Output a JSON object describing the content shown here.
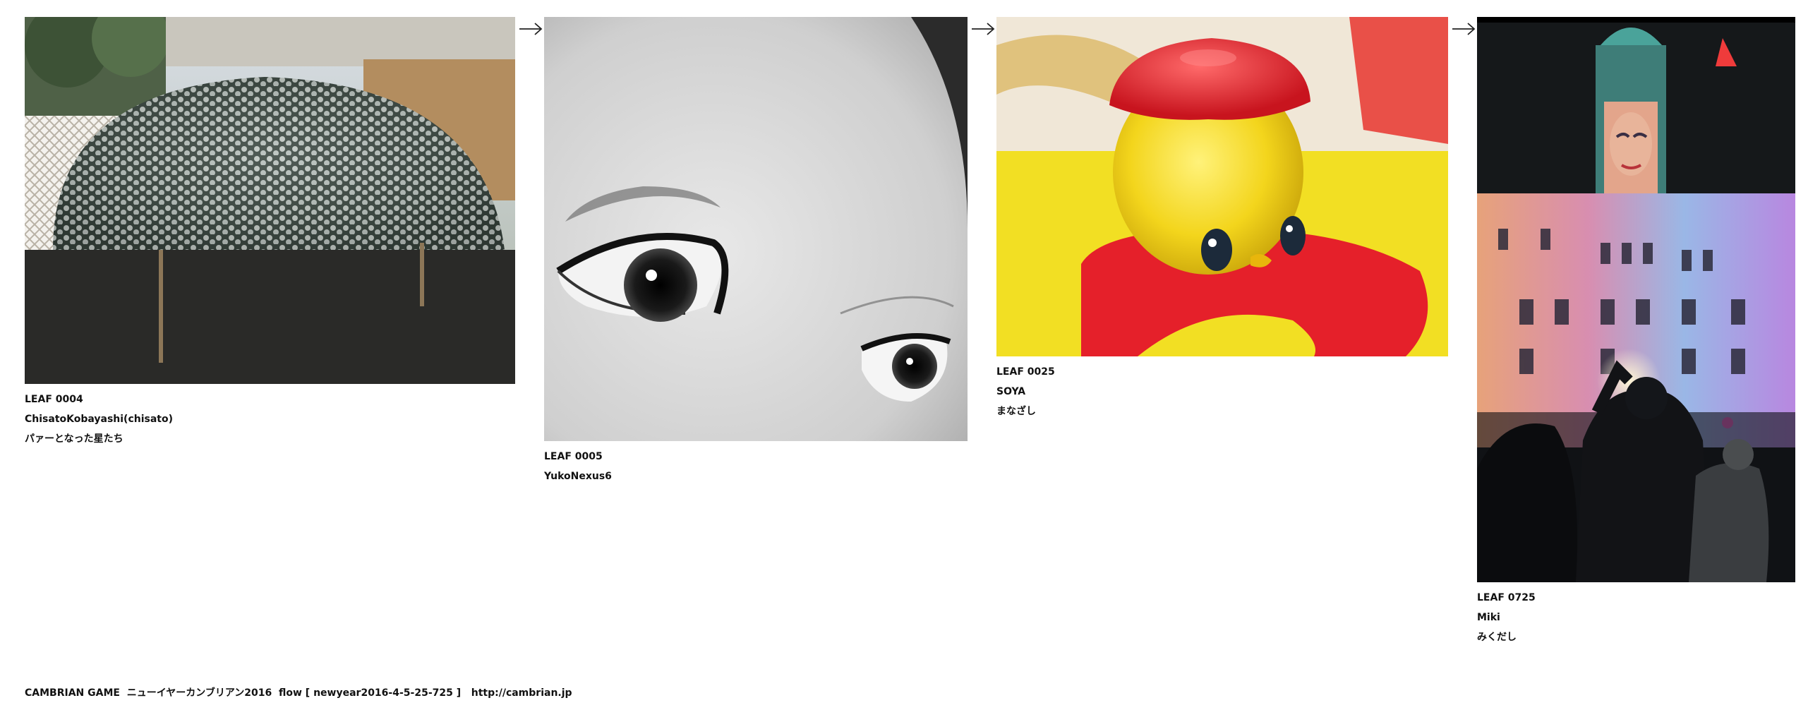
{
  "leaves": [
    {
      "id": "LEAF 0004",
      "author": "ChisatoKobayashi(chisato)",
      "title": "パァーとなった星たち"
    },
    {
      "id": "LEAF 0005",
      "author": "YukoNexus6",
      "title": ""
    },
    {
      "id": "LEAF 0025",
      "author": "SOYA",
      "title": "まなざし"
    },
    {
      "id": "LEAF 0725",
      "author": "Miki",
      "title": "みくだし"
    }
  ],
  "arrow_glyph": "→",
  "footer": {
    "text": "CAMBRIAN GAME  ニューイヤーカンブリアン2016  flow [ newyear2016-4-5-25-725 ]   http://cambrian.jp"
  },
  "icons": {
    "arrow": "right-arrow-icon"
  }
}
